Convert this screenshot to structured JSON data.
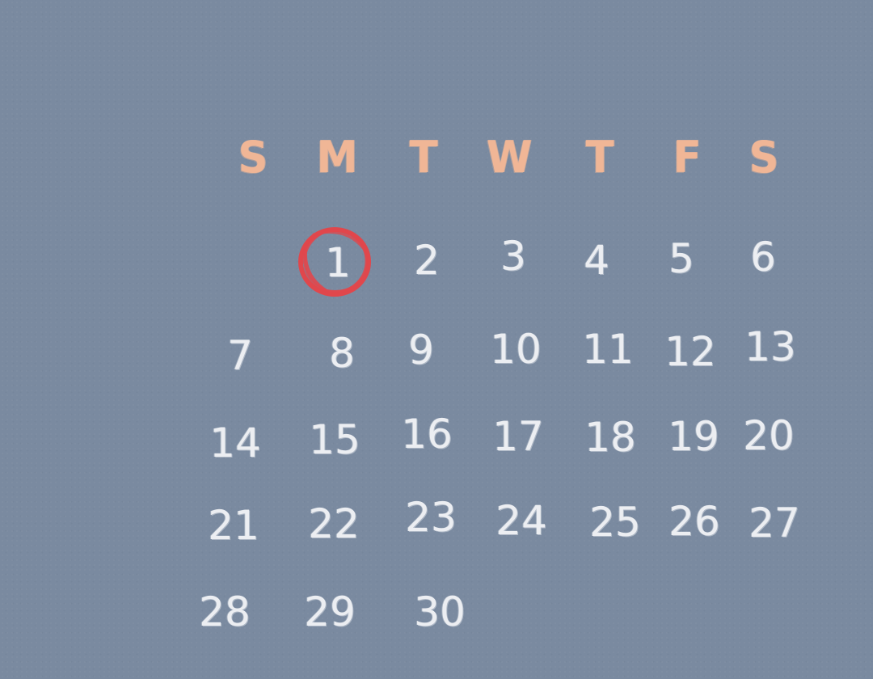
{
  "calendar": {
    "weekdays": [
      "S",
      "M",
      "T",
      "W",
      "T",
      "F",
      "S"
    ],
    "weeks": [
      [
        "",
        "1",
        "2",
        "3",
        "4",
        "5",
        "6"
      ],
      [
        "7",
        "8",
        "9",
        "10",
        "11",
        "12",
        "13"
      ],
      [
        "14",
        "15",
        "16",
        "17",
        "18",
        "19",
        "20"
      ],
      [
        "21",
        "22",
        "23",
        "24",
        "25",
        "26",
        "27"
      ],
      [
        "28",
        "29",
        "30",
        "",
        "",
        "",
        ""
      ]
    ],
    "highlighted_day": "1",
    "colors": {
      "background": "#7a8aa0",
      "weekday_text": "#f0b696",
      "day_text": "#eceef2",
      "highlight_circle": "#e0474c"
    }
  }
}
